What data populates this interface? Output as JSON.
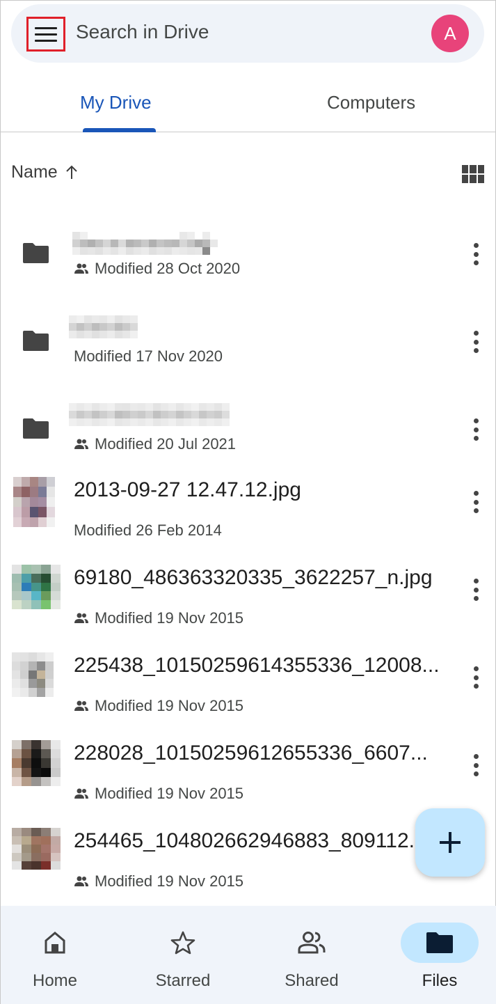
{
  "search": {
    "placeholder": "Search in Drive",
    "avatar_letter": "A",
    "avatar_color": "#e8437a"
  },
  "tabs": [
    {
      "label": "My Drive",
      "active": true
    },
    {
      "label": "Computers",
      "active": false
    }
  ],
  "sort": {
    "label": "Name",
    "direction_icon": "arrow-up-icon",
    "view_toggle_icon": "grid-view-icon"
  },
  "files": [
    {
      "type": "folder",
      "name": "",
      "name_redacted": true,
      "shared": true,
      "modified": "Modified 28 Oct 2020"
    },
    {
      "type": "folder",
      "name": "",
      "name_redacted": true,
      "shared": false,
      "modified": "Modified 17 Nov 2020"
    },
    {
      "type": "folder",
      "name": "",
      "name_redacted": true,
      "shared": true,
      "modified": "Modified 20 Jul 2021"
    },
    {
      "type": "image",
      "name": "2013-09-27 12.47.12.jpg",
      "shared": false,
      "modified": "Modified 26 Feb 2014"
    },
    {
      "type": "image",
      "name": "69180_486363320335_3622257_n.jpg",
      "shared": true,
      "modified": "Modified 19 Nov 2015"
    },
    {
      "type": "image",
      "name": "225438_10150259614355336_12008...",
      "shared": true,
      "modified": "Modified 19 Nov 2015"
    },
    {
      "type": "image",
      "name": "228028_10150259612655336_6607...",
      "shared": true,
      "modified": "Modified 19 Nov 2015"
    },
    {
      "type": "image",
      "name": "254465_104802662946883_809112...",
      "shared": true,
      "modified": "Modified 19 Nov 2015"
    }
  ],
  "fab": {
    "icon": "plus-icon"
  },
  "bottom_nav": [
    {
      "label": "Home",
      "icon": "home-icon",
      "active": false
    },
    {
      "label": "Starred",
      "icon": "star-icon",
      "active": false
    },
    {
      "label": "Shared",
      "icon": "people-icon",
      "active": false
    },
    {
      "label": "Files",
      "icon": "folder-icon",
      "active": true
    }
  ],
  "colors": {
    "accent": "#1a56b8",
    "search_bg": "#eff3f9",
    "active_pill": "#c2e7ff",
    "nav_bg": "#f0f4fa"
  }
}
